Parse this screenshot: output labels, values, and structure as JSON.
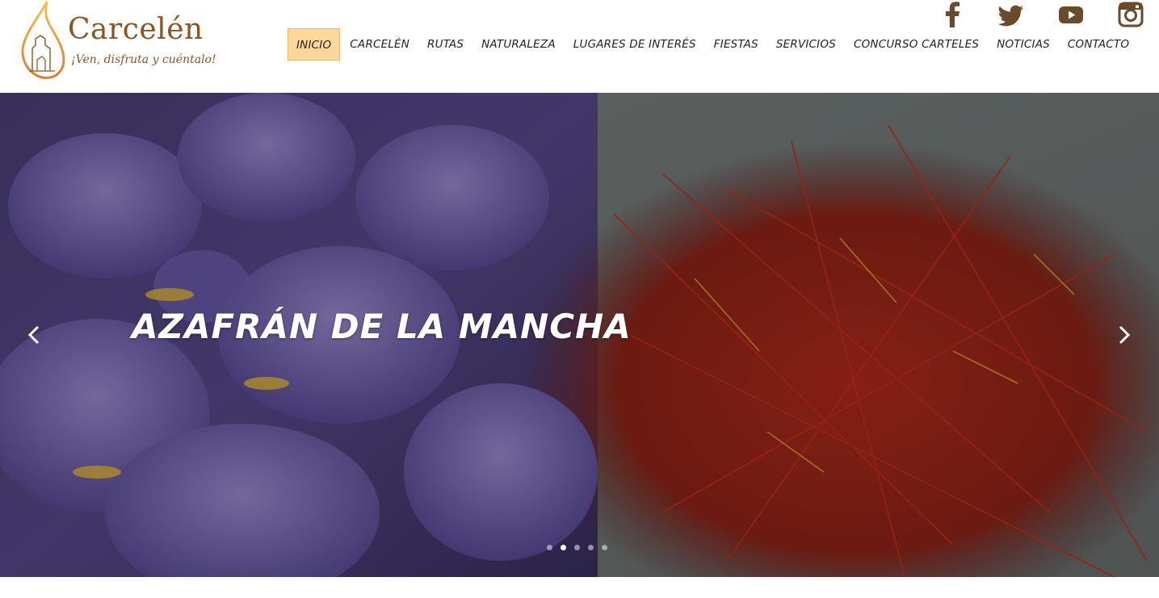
{
  "brand": {
    "title": "Carcelén",
    "tagline": "¡Ven, disfruta y cuéntalo!",
    "color": "#8a5520"
  },
  "nav": {
    "items": [
      {
        "label": "INICIO",
        "active": true
      },
      {
        "label": "CARCELÉN"
      },
      {
        "label": "RUTAS"
      },
      {
        "label": "NATURALEZA"
      },
      {
        "label": "LUGARES DE INTERÉS"
      },
      {
        "label": "FIESTAS"
      },
      {
        "label": "SERVICIOS"
      },
      {
        "label": "CONCURSO CARTELES"
      },
      {
        "label": "NOTICIAS"
      },
      {
        "label": "CONTACTO"
      }
    ],
    "active_color": "#fbd79a"
  },
  "social": {
    "icons": [
      "facebook-icon",
      "twitter-icon",
      "youtube-icon",
      "instagram-icon"
    ],
    "color": "#6b4a2a"
  },
  "slider": {
    "caption": "AZAFRÁN DE LA MANCHA",
    "slide_count": 5,
    "active_slide": 2
  }
}
